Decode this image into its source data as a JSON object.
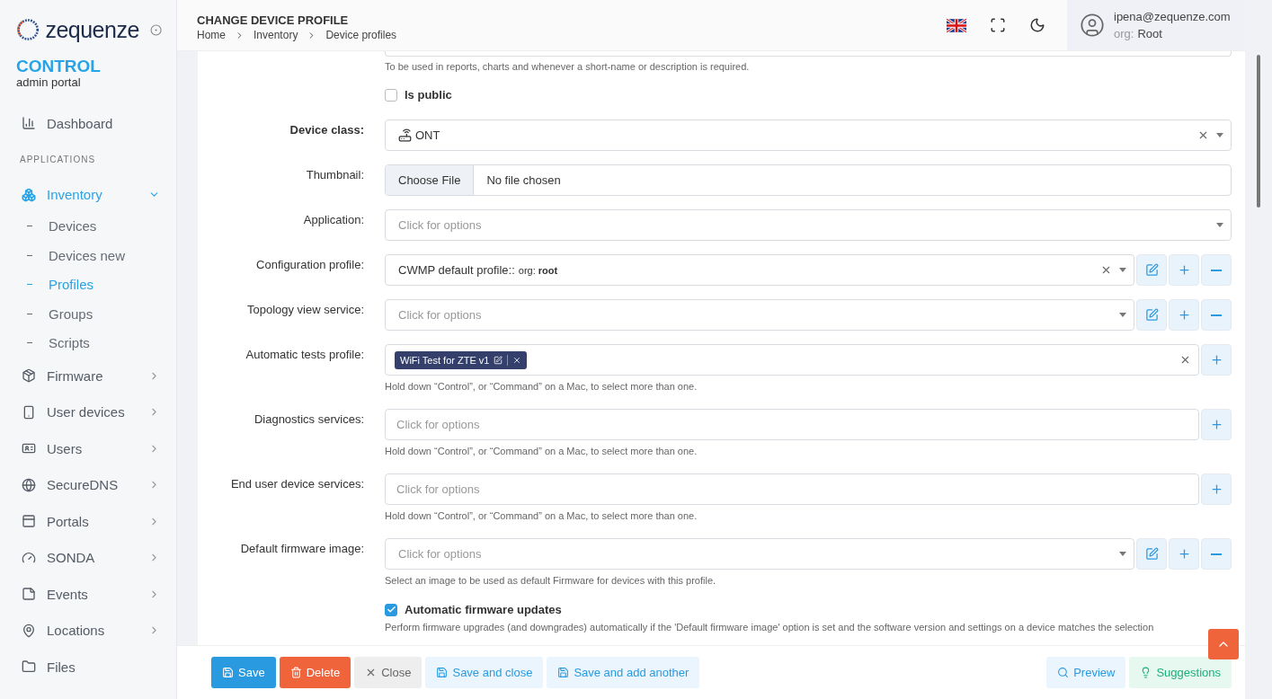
{
  "sidebar": {
    "logo": "zequenze",
    "brand": "CONTROL",
    "subtitle": "admin portal",
    "items": [
      {
        "kind": "link",
        "label": "Dashboard",
        "selected": false
      },
      {
        "kind": "section",
        "label": "APPLICATIONS"
      },
      {
        "kind": "group",
        "label": "Inventory",
        "selected": true,
        "expanded": true,
        "children": [
          {
            "label": "Devices",
            "selected": false
          },
          {
            "label": "Devices new",
            "selected": false
          },
          {
            "label": "Profiles",
            "selected": true
          },
          {
            "label": "Groups",
            "selected": false
          },
          {
            "label": "Scripts",
            "selected": false
          }
        ]
      },
      {
        "kind": "group",
        "label": "Firmware",
        "selected": false,
        "expanded": false
      },
      {
        "kind": "group",
        "label": "User devices",
        "selected": false,
        "expanded": false
      },
      {
        "kind": "group",
        "label": "Users",
        "selected": false,
        "expanded": false
      },
      {
        "kind": "group",
        "label": "SecureDNS",
        "selected": false,
        "expanded": false
      },
      {
        "kind": "group",
        "label": "Portals",
        "selected": false,
        "expanded": false
      },
      {
        "kind": "group",
        "label": "SONDA",
        "selected": false,
        "expanded": false
      },
      {
        "kind": "group",
        "label": "Events",
        "selected": false,
        "expanded": false
      },
      {
        "kind": "group",
        "label": "Locations",
        "selected": false,
        "expanded": false
      },
      {
        "kind": "link",
        "label": "Files",
        "selected": false
      }
    ]
  },
  "header": {
    "title": "CHANGE DEVICE PROFILE",
    "breadcrumbs": [
      "Home",
      "Inventory",
      "Device profiles"
    ],
    "user": {
      "email": "ipena@zequenze.com",
      "org_label": "org:",
      "org": "Root"
    }
  },
  "form": {
    "top_help": "To be used in reports, charts and whenever a short-name or description is required.",
    "fields": [
      {
        "kind": "checkbox",
        "text": "Is public",
        "checked": false
      },
      {
        "kind": "select",
        "label": "Device class:",
        "required": true,
        "value": "ONT",
        "clearable": true,
        "caret": true
      },
      {
        "kind": "file",
        "label": "Thumbnail:",
        "button": "Choose File",
        "value": "No file chosen"
      },
      {
        "kind": "select",
        "label": "Application:",
        "required": false,
        "placeholder": "Click for options",
        "clearable": false,
        "caret": true
      },
      {
        "kind": "select",
        "label": "Configuration profile:",
        "required": false,
        "value": "CWMP default profile::",
        "suffix": "org: **root**",
        "clearable": true,
        "caret": true,
        "edit_button": true,
        "add_button": true,
        "remove_button": true
      },
      {
        "kind": "select",
        "label": "Topology view service:",
        "required": false,
        "placeholder": "Click for options",
        "clearable": false,
        "caret": true,
        "edit_button": true,
        "add_button": true,
        "remove_button": true
      },
      {
        "kind": "multi",
        "label": "Automatic tests profile:",
        "required": false,
        "tags": [
          "WiFi Test for ZTE v1"
        ],
        "clearable": true,
        "caret": false,
        "add_button": true,
        "help": "Hold down “Control”, or “Command” on a Mac, to select more than one."
      },
      {
        "kind": "multi",
        "label": "Diagnostics services:",
        "required": false,
        "placeholder": "Click for options",
        "clearable": false,
        "caret": false,
        "add_button": true,
        "help": "Hold down “Control”, or “Command” on a Mac, to select more than one."
      },
      {
        "kind": "multi",
        "label": "End user device services:",
        "required": false,
        "placeholder": "Click for options",
        "clearable": false,
        "caret": false,
        "add_button": true,
        "help": "Hold down “Control”, or “Command” on a Mac, to select more than one."
      },
      {
        "kind": "select",
        "label": "Default firmware image:",
        "required": false,
        "placeholder": "Click for options",
        "clearable": false,
        "caret": true,
        "edit_button": true,
        "add_button": true,
        "remove_button": true,
        "help": "Select an image to be used as default Firmware for devices with this profile."
      },
      {
        "kind": "checkbox",
        "text": "Automatic firmware updates",
        "checked": true,
        "help": "Perform firmware upgrades (and downgrades) automatically if the 'Default firmware image' option is set and the software version and settings on a device matches the selection"
      }
    ]
  },
  "actions": [
    {
      "kind": "primary",
      "label": "Save"
    },
    {
      "kind": "danger",
      "label": "Delete"
    },
    {
      "kind": "plain",
      "label": "Close"
    },
    {
      "kind": "light",
      "label": "Save and close"
    },
    {
      "kind": "light",
      "label": "Save and add another"
    },
    {
      "kind": "spacer"
    },
    {
      "kind": "light",
      "label": "Preview"
    },
    {
      "kind": "success",
      "label": "Suggestions"
    }
  ]
}
